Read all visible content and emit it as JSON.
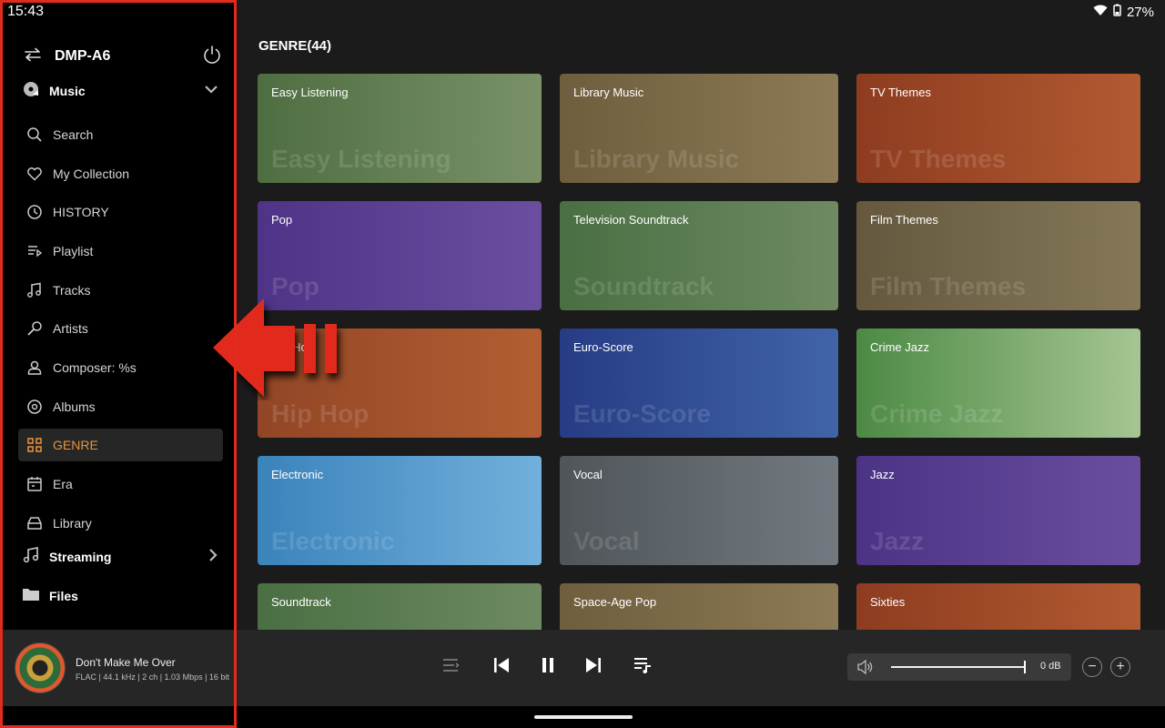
{
  "status": {
    "time": "15:43",
    "battery": "27%"
  },
  "sidebar": {
    "device_name": "DMP-A6",
    "music_label": "Music",
    "items": [
      {
        "label": "Search",
        "icon": "search-icon"
      },
      {
        "label": "My Collection",
        "icon": "heart-icon"
      },
      {
        "label": "HISTORY",
        "icon": "clock-icon"
      },
      {
        "label": "Playlist",
        "icon": "playlist-icon"
      },
      {
        "label": "Tracks",
        "icon": "music-note-icon"
      },
      {
        "label": "Artists",
        "icon": "microphone-icon"
      },
      {
        "label": "Composer: %s",
        "icon": "person-icon"
      },
      {
        "label": "Albums",
        "icon": "disc-icon"
      },
      {
        "label": "GENRE",
        "icon": "grid-icon",
        "active": true
      },
      {
        "label": "Era",
        "icon": "calendar-icon"
      },
      {
        "label": "Library",
        "icon": "library-icon"
      }
    ],
    "streaming_label": "Streaming",
    "files_label": "Files"
  },
  "main": {
    "title": "GENRE(44)",
    "tiles": [
      {
        "label": "Easy Listening",
        "ghost": "Easy Listening",
        "from": "#4e6e41",
        "to": "#7a9168"
      },
      {
        "label": "Library Music",
        "ghost": "Library Music",
        "from": "#6e5e3d",
        "to": "#8d7a56"
      },
      {
        "label": "TV Themes",
        "ghost": "TV Themes",
        "from": "#8e3c20",
        "to": "#b25a31"
      },
      {
        "label": "Pop",
        "ghost": "Pop",
        "from": "#4e3386",
        "to": "#6b4ea0"
      },
      {
        "label": "Television Soundtrack",
        "ghost": "Soundtrack",
        "from": "#4a6f43",
        "to": "#6e8a62"
      },
      {
        "label": "Film Themes",
        "ghost": "Film Themes",
        "from": "#65583e",
        "to": "#847858"
      },
      {
        "label": "Hip Hop",
        "ghost": "Hip Hop",
        "from": "#924626",
        "to": "#b35e32"
      },
      {
        "label": "Euro-Score",
        "ghost": "Euro-Score",
        "from": "#263c84",
        "to": "#4164a8"
      },
      {
        "label": "Crime Jazz",
        "ghost": "Crime Jazz",
        "from": "#4c8a44",
        "to": "#a6c593"
      },
      {
        "label": "Electronic",
        "ghost": "Electronic",
        "from": "#3a83bb",
        "to": "#72b0dc"
      },
      {
        "label": "Vocal",
        "ghost": "Vocal",
        "from": "#4f5559",
        "to": "#727a81"
      },
      {
        "label": "Jazz",
        "ghost": "Jazz",
        "from": "#4b3386",
        "to": "#6a4e9e"
      },
      {
        "label": "Soundtrack",
        "ghost": "Soundtrack",
        "from": "#4a6f43",
        "to": "#6e8a62"
      },
      {
        "label": "Space-Age Pop",
        "ghost": "Space-Age Pop",
        "from": "#6e5e3d",
        "to": "#8d7a56"
      },
      {
        "label": "Sixties",
        "ghost": "Sixties",
        "from": "#8e3c20",
        "to": "#b25a31"
      }
    ]
  },
  "player": {
    "title": "Don't Make Me Over",
    "info": "FLAC | 44.1 kHz | 2 ch | 1.03 Mbps | 16 bit",
    "volume_db": "0 dB",
    "volume_level": 1.0
  },
  "colors": {
    "accent": "#e5953d",
    "highlight_outline": "#e12b1c"
  }
}
